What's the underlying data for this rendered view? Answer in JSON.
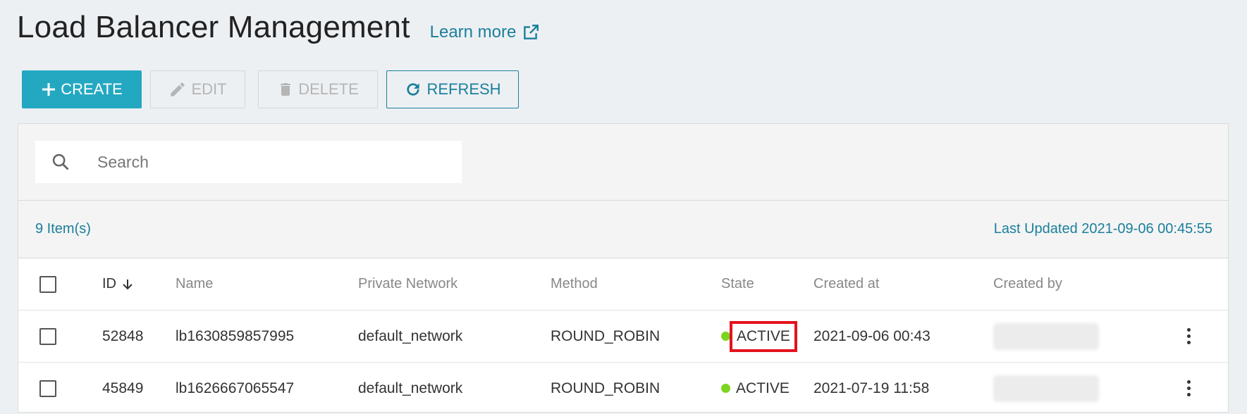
{
  "header": {
    "title": "Load Balancer Management",
    "learn_more": "Learn more"
  },
  "toolbar": {
    "create_label": "CREATE",
    "edit_label": "EDIT",
    "delete_label": "DELETE",
    "refresh_label": "REFRESH"
  },
  "search": {
    "placeholder": "Search",
    "value": ""
  },
  "summary": {
    "item_count": "9 Item(s)",
    "last_updated": "Last Updated 2021-09-06 00:45:55"
  },
  "table": {
    "columns": {
      "id": "ID",
      "name": "Name",
      "network": "Private Network",
      "method": "Method",
      "state": "State",
      "created_at": "Created at",
      "created_by": "Created by"
    },
    "rows": [
      {
        "id": "52848",
        "name": "lb1630859857995",
        "network": "default_network",
        "method": "ROUND_ROBIN",
        "state": "ACTIVE",
        "created_at": "2021-09-06 00:43",
        "highlighted": true
      },
      {
        "id": "45849",
        "name": "lb1626667065547",
        "network": "default_network",
        "method": "ROUND_ROBIN",
        "state": "ACTIVE",
        "created_at": "2021-07-19 11:58",
        "highlighted": false
      }
    ]
  },
  "colors": {
    "accent": "#24a8c2",
    "link": "#1a7f9c",
    "active_status": "#7ed321",
    "highlight_border": "#e3121d"
  },
  "icons": [
    "external-link-icon",
    "plus-icon",
    "pencil-icon",
    "trash-icon",
    "refresh-icon",
    "search-icon",
    "sort-down-arrow-icon",
    "kebab-menu-icon"
  ]
}
